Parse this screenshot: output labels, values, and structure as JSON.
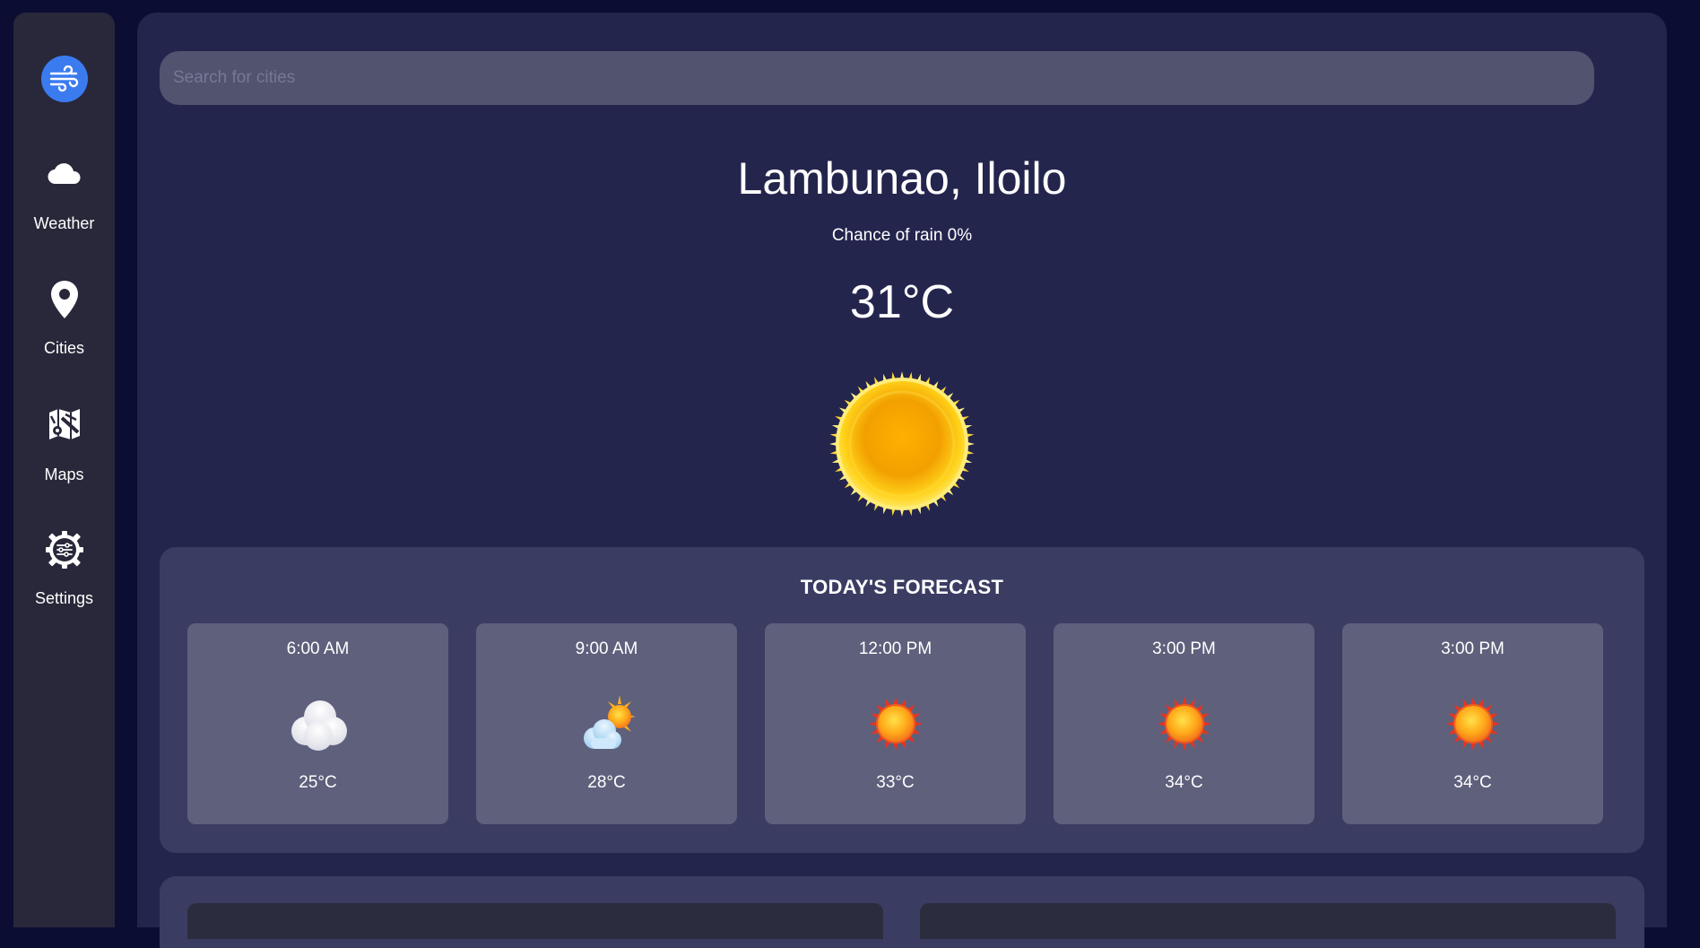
{
  "sidebar": {
    "logo_icon": "wind-icon",
    "items": [
      {
        "label": "Weather",
        "icon": "cloud-icon"
      },
      {
        "label": "Cities",
        "icon": "map-pin-icon"
      },
      {
        "label": "Maps",
        "icon": "map-icon"
      },
      {
        "label": "Settings",
        "icon": "settings-icon"
      }
    ]
  },
  "search": {
    "placeholder": "Search for cities",
    "value": ""
  },
  "current": {
    "city": "Lambunao, Iloilo",
    "rain": "Chance of rain 0%",
    "temperature": "31°C",
    "icon": "sun-icon"
  },
  "forecast": {
    "title": "TODAY'S FORECAST",
    "items": [
      {
        "time": "6:00 AM",
        "temp": "25°C",
        "icon": "cloud-icon"
      },
      {
        "time": "9:00 AM",
        "temp": "28°C",
        "icon": "partly-sunny-icon"
      },
      {
        "time": "12:00 PM",
        "temp": "33°C",
        "icon": "sun-icon"
      },
      {
        "time": "3:00 PM",
        "temp": "34°C",
        "icon": "sun-icon"
      },
      {
        "time": "3:00 PM",
        "temp": "34°C",
        "icon": "sun-icon"
      }
    ]
  },
  "colors": {
    "background": "#0c0d33",
    "sidebar": "#28283a",
    "main": "#24254d",
    "panel": "#3b3c62",
    "card": "#5f607c",
    "accent": "#3b7bf0"
  }
}
